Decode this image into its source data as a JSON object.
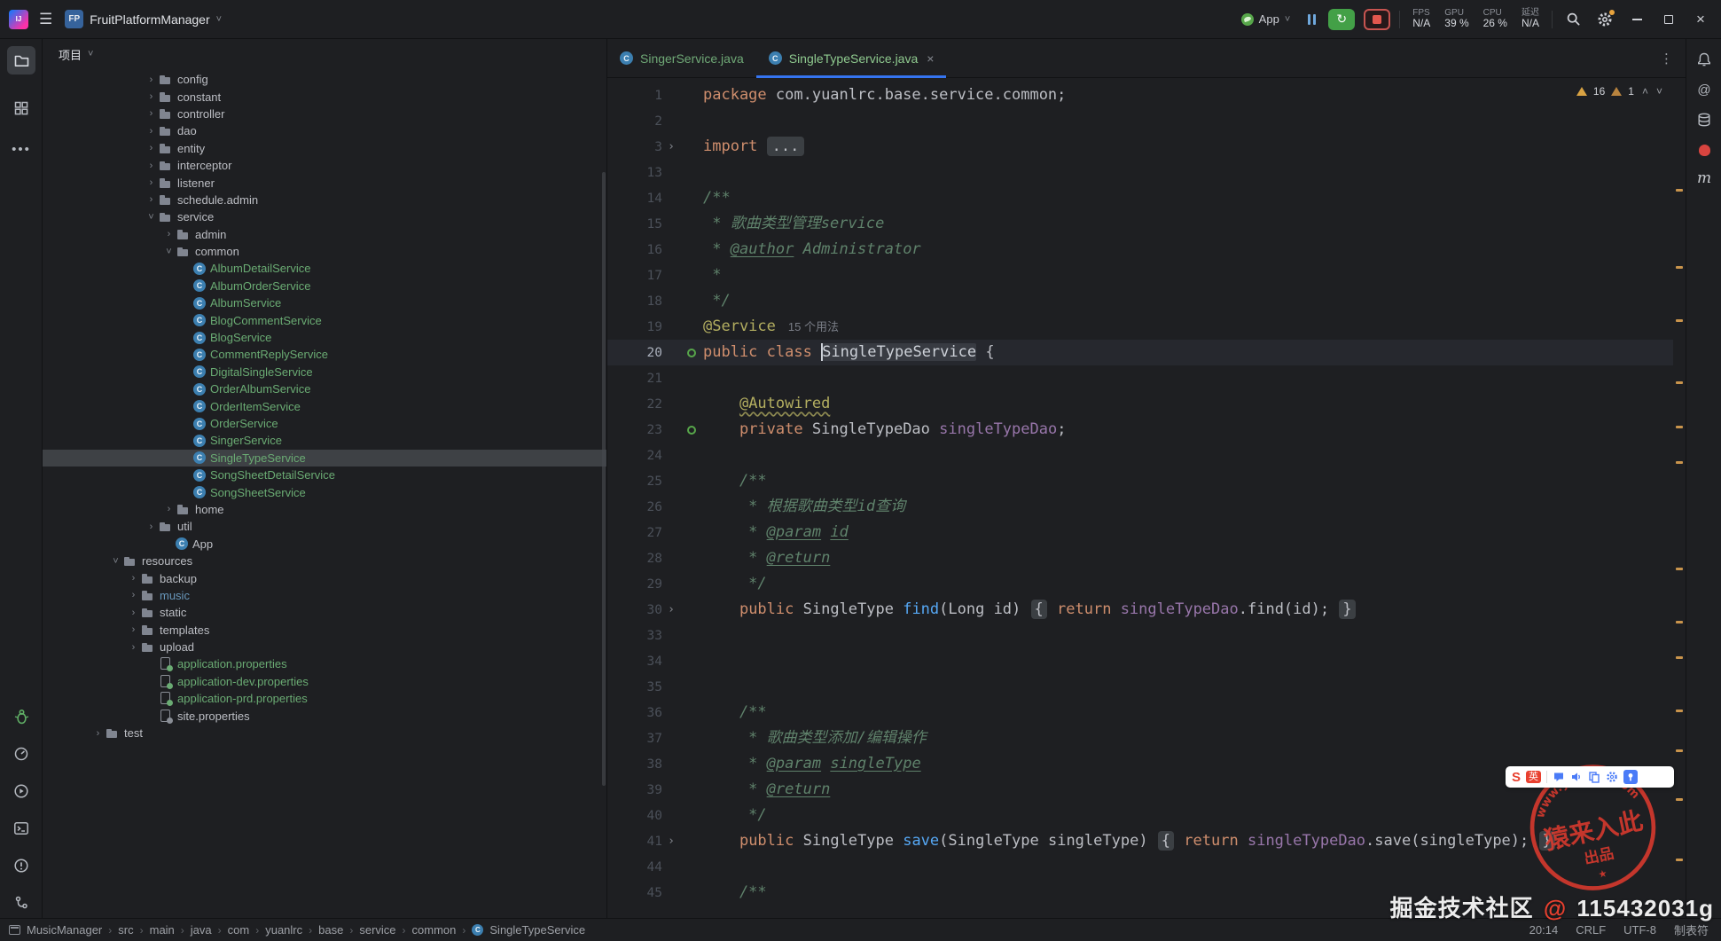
{
  "titlebar": {
    "app_icon": "IJ",
    "project_badge": "FP",
    "project_name": "FruitPlatformManager",
    "run_config": "App",
    "perf": [
      {
        "label": "FPS",
        "value": "N/A"
      },
      {
        "label": "GPU",
        "value": "39 %"
      },
      {
        "label": "CPU",
        "value": "26 %"
      },
      {
        "label": "延迟",
        "value": "N/A"
      }
    ]
  },
  "project_panel": {
    "title": "项目",
    "tree": [
      {
        "label": "config",
        "icon": "folder",
        "chev": "right",
        "ind": 115
      },
      {
        "label": "constant",
        "icon": "folder",
        "chev": "right",
        "ind": 115
      },
      {
        "label": "controller",
        "icon": "folder",
        "chev": "right",
        "ind": 115
      },
      {
        "label": "dao",
        "icon": "folder",
        "chev": "right",
        "ind": 115
      },
      {
        "label": "entity",
        "icon": "folder",
        "chev": "right",
        "ind": 115
      },
      {
        "label": "interceptor",
        "icon": "folder",
        "chev": "right",
        "ind": 115
      },
      {
        "label": "listener",
        "icon": "folder",
        "chev": "right",
        "ind": 115
      },
      {
        "label": "schedule.admin",
        "icon": "folder",
        "chev": "right",
        "ind": 115
      },
      {
        "label": "service",
        "icon": "folder",
        "chev": "down",
        "ind": 115
      },
      {
        "label": "admin",
        "icon": "folder",
        "chev": "right",
        "ind": 135
      },
      {
        "label": "common",
        "icon": "folder",
        "chev": "down",
        "ind": 135
      },
      {
        "label": "AlbumDetailService",
        "icon": "class",
        "ind": 155,
        "color": "green"
      },
      {
        "label": "AlbumOrderService",
        "icon": "class",
        "ind": 155,
        "color": "green"
      },
      {
        "label": "AlbumService",
        "icon": "class",
        "ind": 155,
        "color": "green"
      },
      {
        "label": "BlogCommentService",
        "icon": "class",
        "ind": 155,
        "color": "green"
      },
      {
        "label": "BlogService",
        "icon": "class",
        "ind": 155,
        "color": "green"
      },
      {
        "label": "CommentReplyService",
        "icon": "class",
        "ind": 155,
        "color": "green"
      },
      {
        "label": "DigitalSingleService",
        "icon": "class",
        "ind": 155,
        "color": "green"
      },
      {
        "label": "OrderAlbumService",
        "icon": "class",
        "ind": 155,
        "color": "green"
      },
      {
        "label": "OrderItemService",
        "icon": "class",
        "ind": 155,
        "color": "green"
      },
      {
        "label": "OrderService",
        "icon": "class",
        "ind": 155,
        "color": "green"
      },
      {
        "label": "SingerService",
        "icon": "class",
        "ind": 155,
        "color": "green"
      },
      {
        "label": "SingleTypeService",
        "icon": "class",
        "ind": 155,
        "color": "green",
        "selected": true
      },
      {
        "label": "SongSheetDetailService",
        "icon": "class",
        "ind": 155,
        "color": "green"
      },
      {
        "label": "SongSheetService",
        "icon": "class",
        "ind": 155,
        "color": "green"
      },
      {
        "label": "home",
        "icon": "folder",
        "chev": "right",
        "ind": 135
      },
      {
        "label": "util",
        "icon": "folder",
        "chev": "right",
        "ind": 115
      },
      {
        "label": "App",
        "icon": "class",
        "ind": 135
      },
      {
        "label": "resources",
        "icon": "folder",
        "chev": "down",
        "ind": 75
      },
      {
        "label": "backup",
        "icon": "folder",
        "chev": "right",
        "ind": 95
      },
      {
        "label": "music",
        "icon": "folder",
        "chev": "right",
        "ind": 95,
        "color": "blue"
      },
      {
        "label": "static",
        "icon": "folder",
        "chev": "right",
        "ind": 95
      },
      {
        "label": "templates",
        "icon": "folder",
        "chev": "right",
        "ind": 95
      },
      {
        "label": "upload",
        "icon": "folder",
        "chev": "right",
        "ind": 95
      },
      {
        "label": "application.properties",
        "icon": "props",
        "ind": 115,
        "color": "green"
      },
      {
        "label": "application-dev.properties",
        "icon": "props",
        "ind": 115,
        "color": "green"
      },
      {
        "label": "application-prd.properties",
        "icon": "props",
        "ind": 115,
        "color": "green"
      },
      {
        "label": "site.properties",
        "icon": "props gray",
        "ind": 115
      },
      {
        "label": "test",
        "icon": "folder",
        "chev": "right",
        "ind": 55
      }
    ]
  },
  "tabs": [
    {
      "label": "SingerService.java",
      "active": false
    },
    {
      "label": "SingleTypeService.java",
      "active": true,
      "close": "×"
    }
  ],
  "inspections": {
    "warnings": "16",
    "weak_warnings": "1"
  },
  "editor": {
    "lines": [
      {
        "num": "1",
        "segs": [
          [
            "k",
            "package"
          ],
          [
            "d",
            " com.yuanlrc.base.service.common;"
          ]
        ]
      },
      {
        "num": "2",
        "segs": []
      },
      {
        "num": "3",
        "fold": true,
        "segs": [
          [
            "k",
            "import"
          ],
          [
            "d",
            " "
          ],
          [
            "fd",
            "..."
          ]
        ]
      },
      {
        "num": "13",
        "segs": []
      },
      {
        "num": "14",
        "segs": [
          [
            "c",
            "/**"
          ]
        ]
      },
      {
        "num": "15",
        "segs": [
          [
            "c",
            " * 歌曲类型管理service"
          ]
        ]
      },
      {
        "num": "16",
        "segs": [
          [
            "c",
            " * "
          ],
          [
            "ct",
            "@author"
          ],
          [
            "c",
            " Administrator"
          ]
        ]
      },
      {
        "num": "17",
        "segs": [
          [
            "c",
            " *"
          ]
        ]
      },
      {
        "num": "18",
        "segs": [
          [
            "c",
            " */"
          ]
        ]
      },
      {
        "num": "19",
        "segs": [
          [
            "a",
            "@Service"
          ],
          [
            "h",
            "15 个用法"
          ]
        ]
      },
      {
        "num": "20",
        "cur": true,
        "icon": "bean",
        "segs": [
          [
            "k",
            "public"
          ],
          [
            "d",
            " "
          ],
          [
            "k",
            "class"
          ],
          [
            "d",
            " "
          ],
          [
            "caret",
            ""
          ],
          [
            "hl",
            "SingleTypeService"
          ],
          [
            "d",
            " {"
          ]
        ]
      },
      {
        "num": "21",
        "segs": []
      },
      {
        "num": "22",
        "segs": [
          [
            "d",
            "    "
          ],
          [
            "au",
            "@Autowired"
          ]
        ]
      },
      {
        "num": "23",
        "icon": "bean",
        "segs": [
          [
            "d",
            "    "
          ],
          [
            "k",
            "private"
          ],
          [
            "d",
            " SingleTypeDao "
          ],
          [
            "f",
            "singleTypeDao"
          ],
          [
            "d",
            ";"
          ]
        ]
      },
      {
        "num": "24",
        "segs": []
      },
      {
        "num": "25",
        "segs": [
          [
            "c",
            "    /**"
          ]
        ]
      },
      {
        "num": "26",
        "segs": [
          [
            "c",
            "     * 根据歌曲类型id查询"
          ]
        ]
      },
      {
        "num": "27",
        "segs": [
          [
            "c",
            "     * "
          ],
          [
            "ct",
            "@param"
          ],
          [
            "c",
            " "
          ],
          [
            "cv",
            "id"
          ]
        ]
      },
      {
        "num": "28",
        "segs": [
          [
            "c",
            "     * "
          ],
          [
            "ct",
            "@return"
          ]
        ]
      },
      {
        "num": "29",
        "segs": [
          [
            "c",
            "     */"
          ]
        ]
      },
      {
        "num": "30",
        "fold": true,
        "segs": [
          [
            "d",
            "    "
          ],
          [
            "k",
            "public"
          ],
          [
            "d",
            " SingleType "
          ],
          [
            "m",
            "find"
          ],
          [
            "d",
            "(Long id) "
          ],
          [
            "fb",
            "{"
          ],
          [
            "d",
            " "
          ],
          [
            "k",
            "return"
          ],
          [
            "d",
            " "
          ],
          [
            "f",
            "singleTypeDao"
          ],
          [
            "d",
            ".find(id); "
          ],
          [
            "fb",
            "}"
          ]
        ]
      },
      {
        "num": "33",
        "segs": []
      },
      {
        "num": "34",
        "segs": []
      },
      {
        "num": "35",
        "segs": []
      },
      {
        "num": "36",
        "segs": [
          [
            "c",
            "    /**"
          ]
        ]
      },
      {
        "num": "37",
        "segs": [
          [
            "c",
            "     * 歌曲类型添加/编辑操作"
          ]
        ]
      },
      {
        "num": "38",
        "segs": [
          [
            "c",
            "     * "
          ],
          [
            "ct",
            "@param"
          ],
          [
            "c",
            " "
          ],
          [
            "cv",
            "singleType"
          ]
        ]
      },
      {
        "num": "39",
        "segs": [
          [
            "c",
            "     * "
          ],
          [
            "ct",
            "@return"
          ]
        ]
      },
      {
        "num": "40",
        "segs": [
          [
            "c",
            "     */"
          ]
        ]
      },
      {
        "num": "41",
        "fold": true,
        "segs": [
          [
            "d",
            "    "
          ],
          [
            "k",
            "public"
          ],
          [
            "d",
            " SingleType "
          ],
          [
            "m",
            "save"
          ],
          [
            "d",
            "(SingleType singleType) "
          ],
          [
            "fb",
            "{"
          ],
          [
            "d",
            " "
          ],
          [
            "k",
            "return"
          ],
          [
            "d",
            " "
          ],
          [
            "f",
            "singleTypeDao"
          ],
          [
            "d",
            ".save(singleType); "
          ],
          [
            "fb",
            "}"
          ]
        ]
      },
      {
        "num": "44",
        "segs": []
      },
      {
        "num": "45",
        "segs": [
          [
            "c",
            "    /**"
          ]
        ]
      }
    ],
    "stripe_marks": [
      125,
      212,
      272,
      342,
      392,
      432,
      552,
      612,
      652,
      712,
      757,
      812,
      880
    ]
  },
  "breadcrumbs": {
    "items": [
      "MusicManager",
      "src",
      "main",
      "java",
      "com",
      "yuanlrc",
      "base",
      "service",
      "common",
      "SingleTypeService"
    ]
  },
  "status_right": [
    "20:14",
    "CRLF",
    "UTF-8",
    "制表符"
  ],
  "watermark": {
    "prefix": "掘金技术社区 ",
    "at": "@",
    "suffix": " 115432031g"
  },
  "stamp": {
    "arc_text": "www.yuanlrc.com",
    "main_text": "猿来入此",
    "sub_text": "出品",
    "star": "★"
  },
  "mini_toolbar": {
    "logo": "S",
    "lang": "英"
  }
}
